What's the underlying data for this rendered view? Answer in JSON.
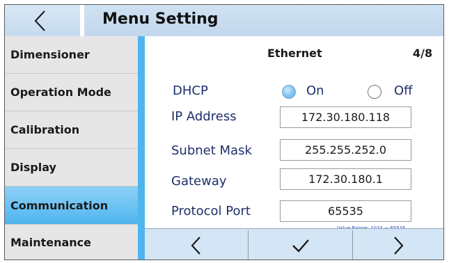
{
  "header": {
    "title": "Menu Setting"
  },
  "sidebar": {
    "items": [
      {
        "label": "Dimensioner"
      },
      {
        "label": "Operation Mode"
      },
      {
        "label": "Calibration"
      },
      {
        "label": "Display"
      },
      {
        "label": "Communication",
        "active": true
      },
      {
        "label": "Maintenance"
      }
    ]
  },
  "panel": {
    "section_title": "Ethernet",
    "page": "4/8",
    "dhcp": {
      "label": "DHCP",
      "options": [
        {
          "label": "On",
          "selected": true
        },
        {
          "label": "Off",
          "selected": false
        }
      ]
    },
    "fields": [
      {
        "label": "IP Address",
        "value": "172.30.180.118"
      },
      {
        "label": "Subnet Mask",
        "value": "255.255.252.0"
      },
      {
        "label": "Gateway",
        "value": "172.30.180.1"
      },
      {
        "label": "Protocol Port",
        "value": "65535"
      }
    ],
    "range_hint": "Value Range: 1024 ~ 65535"
  },
  "footer": {
    "buttons": [
      {
        "icon": "chevron-left-icon"
      },
      {
        "icon": "checkmark-icon"
      },
      {
        "icon": "chevron-right-icon"
      }
    ]
  },
  "colors": {
    "accent": "#4fb5ee",
    "header": "#c6dbef",
    "label_text": "#1f2f6b",
    "hint_text": "#2b55c8"
  }
}
